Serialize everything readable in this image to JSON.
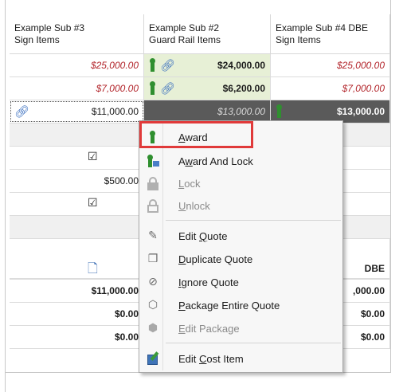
{
  "columns": [
    {
      "line1": "Example Sub #3",
      "line2": "Sign Items"
    },
    {
      "line1": "Example Sub #2",
      "line2": "Guard Rail Items"
    },
    {
      "line1": "Example Sub #4 DBE",
      "line2": "Sign Items"
    }
  ],
  "rows": {
    "r1": {
      "a": "$25,000.00",
      "b": "$24,000.00",
      "c": "$25,000.00"
    },
    "r2": {
      "a": "$7,000.00",
      "b": "$6,200.00",
      "c": "$7,000.00"
    },
    "r3": {
      "a": "$11,000.00",
      "b": "$13,000.00",
      "c": "$13,000.00"
    },
    "r6": {
      "a": "$500.00"
    },
    "r9": {
      "c": "DBE"
    },
    "r11": {
      "a": "$11,000.00",
      "c": ",000.00"
    },
    "r12": {
      "a": "$0.00",
      "c": "$0.00"
    },
    "r13": {
      "a": "$0.00",
      "c": "$0.00"
    }
  },
  "checkbox_glyph": "☑",
  "document_glyph": "🗋",
  "context_menu": {
    "items": [
      {
        "pre": "",
        "u": "A",
        "post": "ward",
        "icon": "award-icon",
        "disabled": false
      },
      {
        "pre": "A",
        "u": "w",
        "post": "ard And Lock",
        "icon": "award-lock-icon",
        "disabled": false
      },
      {
        "pre": "",
        "u": "L",
        "post": "ock",
        "icon": "lock-icon",
        "disabled": true
      },
      {
        "pre": "",
        "u": "U",
        "post": "nlock",
        "icon": "unlock-icon",
        "disabled": true
      },
      {
        "pre": "Edit ",
        "u": "Q",
        "post": "uote",
        "icon": "edit-quote-icon",
        "disabled": false
      },
      {
        "pre": "",
        "u": "D",
        "post": "uplicate Quote",
        "icon": "duplicate-quote-icon",
        "disabled": false
      },
      {
        "pre": "",
        "u": "I",
        "post": "gnore Quote",
        "icon": "ignore-quote-icon",
        "disabled": false
      },
      {
        "pre": "",
        "u": "P",
        "post": "ackage Entire Quote",
        "icon": "package-icon",
        "disabled": false
      },
      {
        "pre": "",
        "u": "E",
        "post": "dit Package",
        "icon": "edit-package-icon",
        "disabled": true
      },
      {
        "pre": "Edit ",
        "u": "C",
        "post": "ost Item",
        "icon": "edit-cost-item-icon",
        "disabled": false
      }
    ]
  },
  "colors": {
    "accent_highlight": "#e03a3a",
    "award_green": "#2f8f2f",
    "link_blue": "#3a6fbf",
    "red_italic": "#b2242a"
  }
}
